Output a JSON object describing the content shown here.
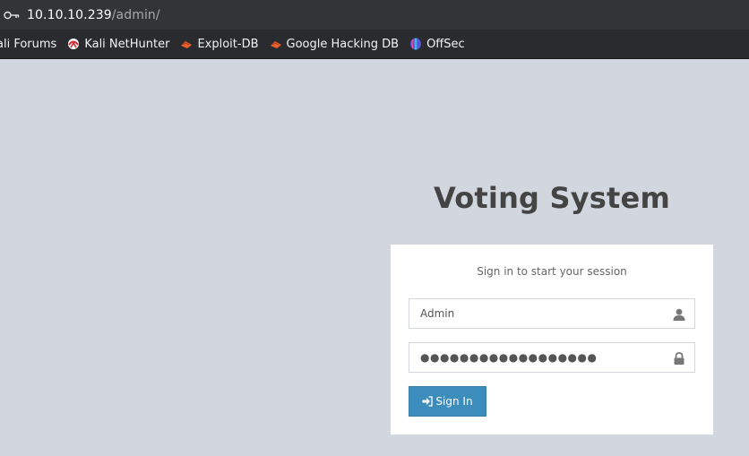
{
  "browser": {
    "url_host": "10.10.10.239",
    "url_path": "/admin/",
    "bookmarks": [
      {
        "label": "ali Forums",
        "icon": "kali-forums-icon"
      },
      {
        "label": "Kali NetHunter",
        "icon": "nethunter-icon"
      },
      {
        "label": "Exploit-DB",
        "icon": "exploit-db-icon"
      },
      {
        "label": "Google Hacking DB",
        "icon": "ghdb-icon"
      },
      {
        "label": "OffSec",
        "icon": "offsec-icon"
      }
    ]
  },
  "page": {
    "logo_title": "Voting System",
    "login_message": "Sign in to start your session",
    "username_value": "Admin",
    "password_value": "●●●●●●●●●●●●●●●●●●",
    "signin_label": "Sign In"
  },
  "colors": {
    "background": "#d2d6de",
    "button": "#3c8dbc",
    "title": "#444444"
  }
}
